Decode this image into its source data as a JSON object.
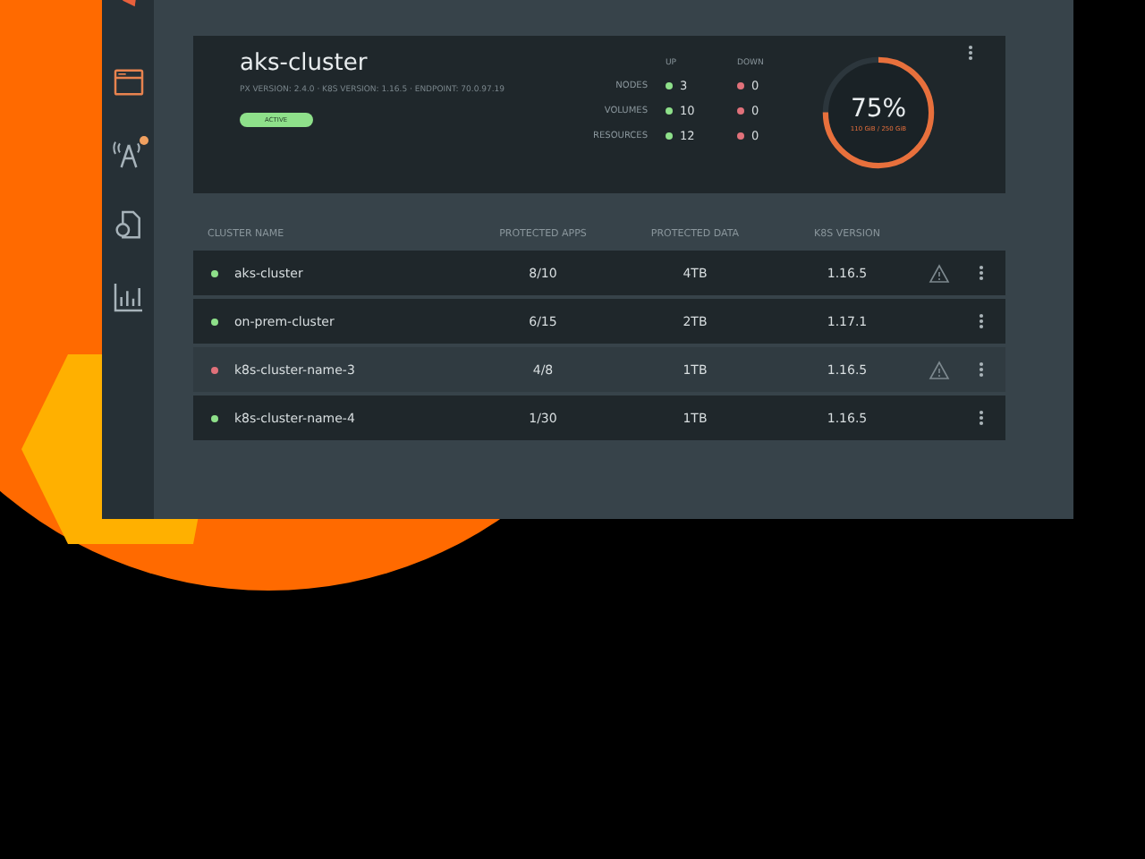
{
  "sidebar": {
    "items": [
      {
        "kind": "window",
        "selected": true
      },
      {
        "kind": "antenna",
        "selected": false,
        "alert": true
      },
      {
        "kind": "document",
        "selected": false
      },
      {
        "kind": "chart",
        "selected": false
      }
    ]
  },
  "cluster_card": {
    "title": "aks-cluster",
    "details": "PX VERSION: 2.4.0 · K8S VERSION: 1.16.5 · ENDPOINT: 70.0.97.19",
    "status": "ACTIVE",
    "stats_headers": [
      "UP",
      "DOWN"
    ],
    "stats": [
      {
        "label": "NODES",
        "up": "3",
        "down": "0"
      },
      {
        "label": "VOLUMES",
        "up": "10",
        "down": "0"
      },
      {
        "label": "RESOURCES",
        "up": "12",
        "down": "0"
      }
    ],
    "usage": {
      "percent": "75%",
      "detail": "110 GiB / 250 GiB",
      "level": 0.75
    }
  },
  "table": {
    "columns": [
      "CLUSTER NAME",
      "PROTECTED APPS",
      "PROTECTED DATA",
      "K8S VERSION"
    ],
    "rows": [
      {
        "name": "aks-cluster",
        "apps": "8/10",
        "data": "4TB",
        "version": "1.16.5",
        "color": "#8ee08a",
        "warning": true,
        "selected": false
      },
      {
        "name": "on-prem-cluster",
        "apps": "6/15",
        "data": "2TB",
        "version": "1.17.1",
        "color": "#8ee08a",
        "warning": false,
        "selected": false
      },
      {
        "name": "k8s-cluster-name-3",
        "apps": "4/8",
        "data": "1TB",
        "version": "1.16.5",
        "color": "#e0717a",
        "warning": true,
        "selected": true
      },
      {
        "name": "k8s-cluster-name-4",
        "apps": "1/30",
        "data": "1TB",
        "version": "1.16.5",
        "color": "#8ee08a",
        "warning": false,
        "selected": false
      }
    ]
  }
}
